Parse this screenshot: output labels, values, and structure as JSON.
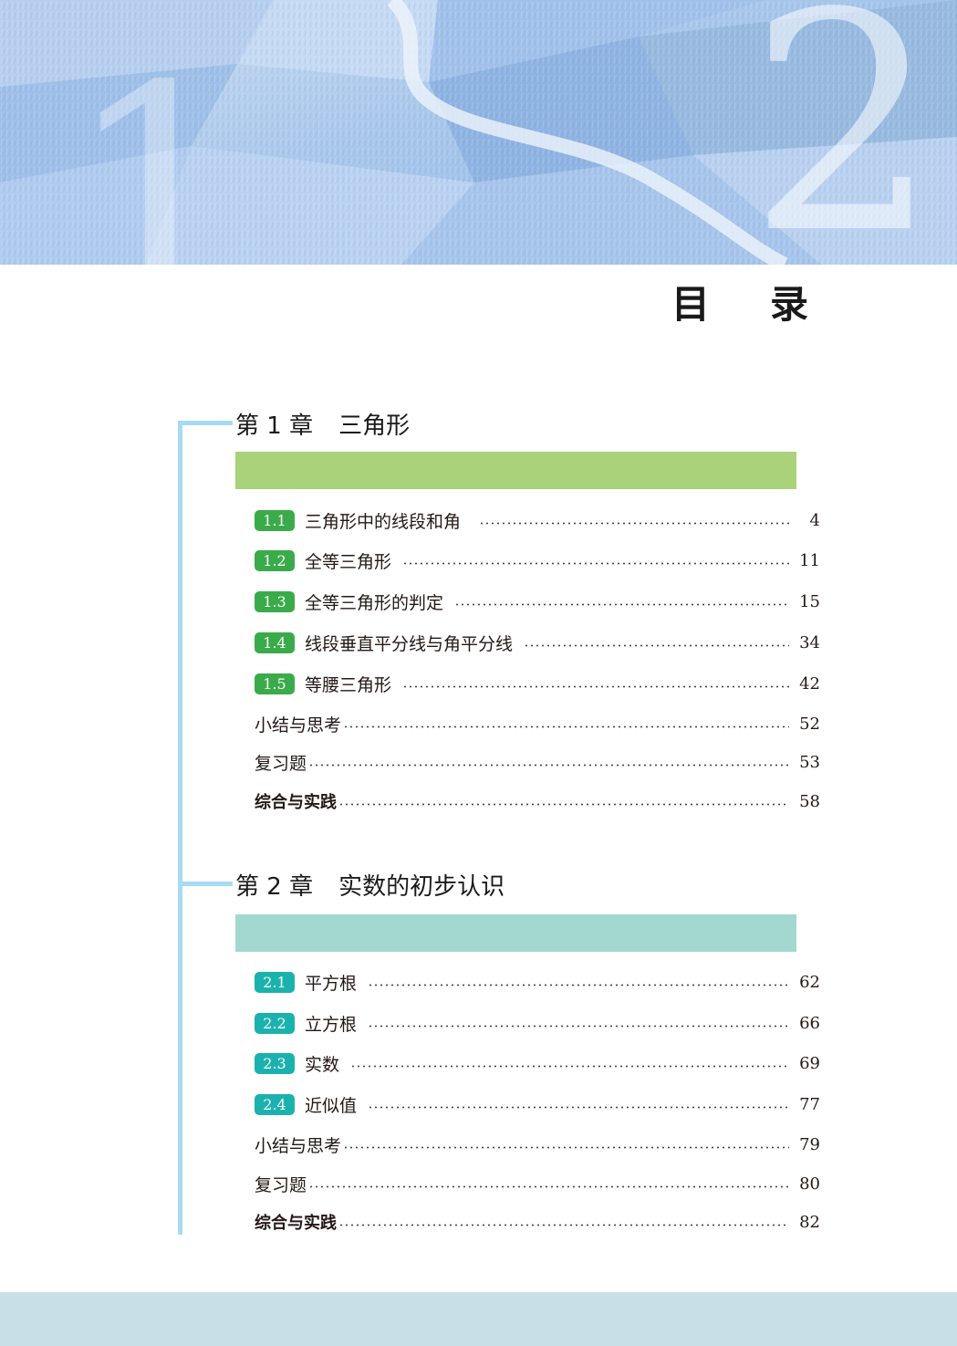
{
  "header": {
    "title_char_1": "目",
    "title_char_2": "录"
  },
  "colors": {
    "timeline": "#a7dbf3",
    "chapter1_bar": "#a9d27b",
    "chapter1_badge": "#3aab4a",
    "chapter2_bar": "#a2d8d0",
    "chapter2_badge": "#1bb2ae",
    "footer": "#c9dfe8"
  },
  "chapters": [
    {
      "number": "第 1 章",
      "name": "三角形",
      "sections": [
        {
          "badge": "1.1",
          "label": "三角形中的线段和角",
          "page": "4"
        },
        {
          "badge": "1.2",
          "label": "全等三角形",
          "page": "11"
        },
        {
          "badge": "1.3",
          "label": "全等三角形的判定",
          "page": "15"
        },
        {
          "badge": "1.4",
          "label": "线段垂直平分线与角平分线",
          "page": "34"
        },
        {
          "badge": "1.5",
          "label": "等腰三角形",
          "page": "42"
        }
      ],
      "extras": [
        {
          "label": "小结与思考",
          "page": "52"
        },
        {
          "label": "复习题",
          "page": "53"
        },
        {
          "label": "综合与实践",
          "page": "58"
        }
      ]
    },
    {
      "number": "第 2 章",
      "name": "实数的初步认识",
      "sections": [
        {
          "badge": "2.1",
          "label": "平方根",
          "page": "62"
        },
        {
          "badge": "2.2",
          "label": "立方根",
          "page": "66"
        },
        {
          "badge": "2.3",
          "label": "实数",
          "page": "69"
        },
        {
          "badge": "2.4",
          "label": "近似值",
          "page": "77"
        }
      ],
      "extras": [
        {
          "label": "小结与思考",
          "page": "79"
        },
        {
          "label": "复习题",
          "page": "80"
        },
        {
          "label": "综合与实践",
          "page": "82"
        }
      ]
    }
  ]
}
